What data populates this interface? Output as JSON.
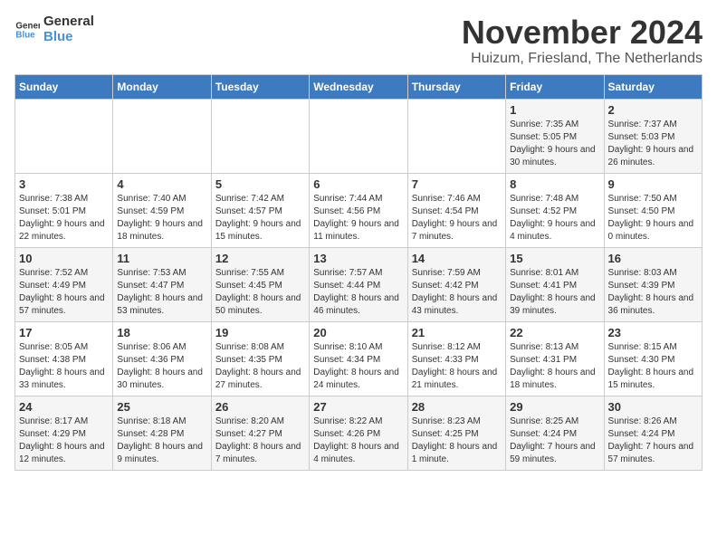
{
  "logo": {
    "general": "General",
    "blue": "Blue"
  },
  "title": "November 2024",
  "location": "Huizum, Friesland, The Netherlands",
  "days_header": [
    "Sunday",
    "Monday",
    "Tuesday",
    "Wednesday",
    "Thursday",
    "Friday",
    "Saturday"
  ],
  "weeks": [
    [
      {
        "day": "",
        "info": ""
      },
      {
        "day": "",
        "info": ""
      },
      {
        "day": "",
        "info": ""
      },
      {
        "day": "",
        "info": ""
      },
      {
        "day": "",
        "info": ""
      },
      {
        "day": "1",
        "info": "Sunrise: 7:35 AM\nSunset: 5:05 PM\nDaylight: 9 hours and 30 minutes."
      },
      {
        "day": "2",
        "info": "Sunrise: 7:37 AM\nSunset: 5:03 PM\nDaylight: 9 hours and 26 minutes."
      }
    ],
    [
      {
        "day": "3",
        "info": "Sunrise: 7:38 AM\nSunset: 5:01 PM\nDaylight: 9 hours and 22 minutes."
      },
      {
        "day": "4",
        "info": "Sunrise: 7:40 AM\nSunset: 4:59 PM\nDaylight: 9 hours and 18 minutes."
      },
      {
        "day": "5",
        "info": "Sunrise: 7:42 AM\nSunset: 4:57 PM\nDaylight: 9 hours and 15 minutes."
      },
      {
        "day": "6",
        "info": "Sunrise: 7:44 AM\nSunset: 4:56 PM\nDaylight: 9 hours and 11 minutes."
      },
      {
        "day": "7",
        "info": "Sunrise: 7:46 AM\nSunset: 4:54 PM\nDaylight: 9 hours and 7 minutes."
      },
      {
        "day": "8",
        "info": "Sunrise: 7:48 AM\nSunset: 4:52 PM\nDaylight: 9 hours and 4 minutes."
      },
      {
        "day": "9",
        "info": "Sunrise: 7:50 AM\nSunset: 4:50 PM\nDaylight: 9 hours and 0 minutes."
      }
    ],
    [
      {
        "day": "10",
        "info": "Sunrise: 7:52 AM\nSunset: 4:49 PM\nDaylight: 8 hours and 57 minutes."
      },
      {
        "day": "11",
        "info": "Sunrise: 7:53 AM\nSunset: 4:47 PM\nDaylight: 8 hours and 53 minutes."
      },
      {
        "day": "12",
        "info": "Sunrise: 7:55 AM\nSunset: 4:45 PM\nDaylight: 8 hours and 50 minutes."
      },
      {
        "day": "13",
        "info": "Sunrise: 7:57 AM\nSunset: 4:44 PM\nDaylight: 8 hours and 46 minutes."
      },
      {
        "day": "14",
        "info": "Sunrise: 7:59 AM\nSunset: 4:42 PM\nDaylight: 8 hours and 43 minutes."
      },
      {
        "day": "15",
        "info": "Sunrise: 8:01 AM\nSunset: 4:41 PM\nDaylight: 8 hours and 39 minutes."
      },
      {
        "day": "16",
        "info": "Sunrise: 8:03 AM\nSunset: 4:39 PM\nDaylight: 8 hours and 36 minutes."
      }
    ],
    [
      {
        "day": "17",
        "info": "Sunrise: 8:05 AM\nSunset: 4:38 PM\nDaylight: 8 hours and 33 minutes."
      },
      {
        "day": "18",
        "info": "Sunrise: 8:06 AM\nSunset: 4:36 PM\nDaylight: 8 hours and 30 minutes."
      },
      {
        "day": "19",
        "info": "Sunrise: 8:08 AM\nSunset: 4:35 PM\nDaylight: 8 hours and 27 minutes."
      },
      {
        "day": "20",
        "info": "Sunrise: 8:10 AM\nSunset: 4:34 PM\nDaylight: 8 hours and 24 minutes."
      },
      {
        "day": "21",
        "info": "Sunrise: 8:12 AM\nSunset: 4:33 PM\nDaylight: 8 hours and 21 minutes."
      },
      {
        "day": "22",
        "info": "Sunrise: 8:13 AM\nSunset: 4:31 PM\nDaylight: 8 hours and 18 minutes."
      },
      {
        "day": "23",
        "info": "Sunrise: 8:15 AM\nSunset: 4:30 PM\nDaylight: 8 hours and 15 minutes."
      }
    ],
    [
      {
        "day": "24",
        "info": "Sunrise: 8:17 AM\nSunset: 4:29 PM\nDaylight: 8 hours and 12 minutes."
      },
      {
        "day": "25",
        "info": "Sunrise: 8:18 AM\nSunset: 4:28 PM\nDaylight: 8 hours and 9 minutes."
      },
      {
        "day": "26",
        "info": "Sunrise: 8:20 AM\nSunset: 4:27 PM\nDaylight: 8 hours and 7 minutes."
      },
      {
        "day": "27",
        "info": "Sunrise: 8:22 AM\nSunset: 4:26 PM\nDaylight: 8 hours and 4 minutes."
      },
      {
        "day": "28",
        "info": "Sunrise: 8:23 AM\nSunset: 4:25 PM\nDaylight: 8 hours and 1 minute."
      },
      {
        "day": "29",
        "info": "Sunrise: 8:25 AM\nSunset: 4:24 PM\nDaylight: 7 hours and 59 minutes."
      },
      {
        "day": "30",
        "info": "Sunrise: 8:26 AM\nSunset: 4:24 PM\nDaylight: 7 hours and 57 minutes."
      }
    ]
  ]
}
